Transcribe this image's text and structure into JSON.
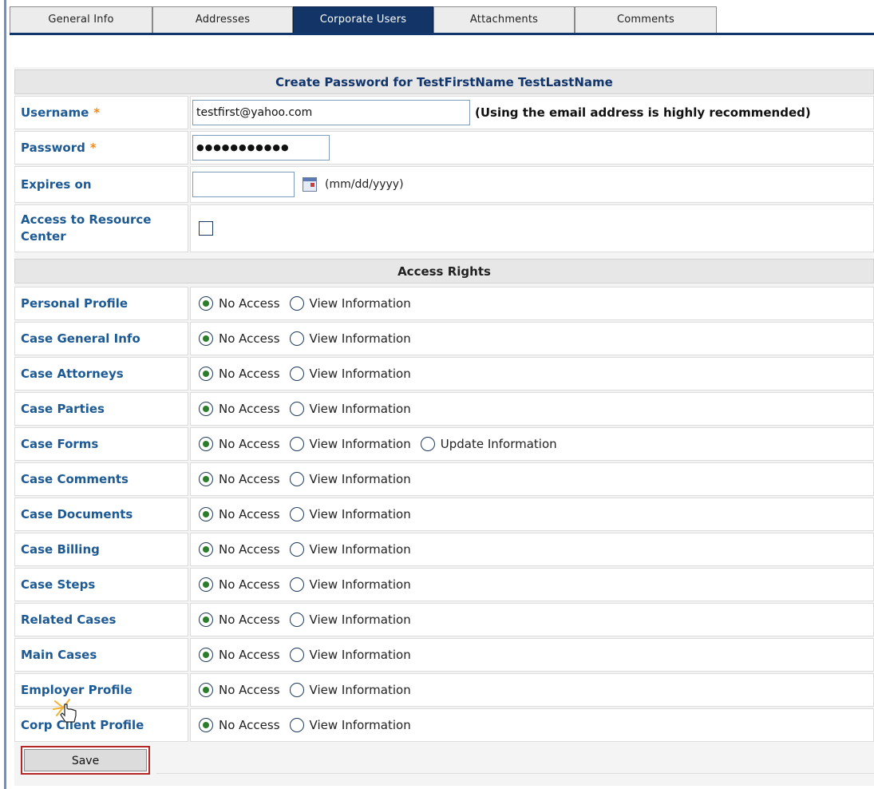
{
  "tabs": [
    {
      "label": "General Info",
      "active": false
    },
    {
      "label": "Addresses",
      "active": false
    },
    {
      "label": "Corporate Users",
      "active": true
    },
    {
      "label": "Attachments",
      "active": false
    },
    {
      "label": "Comments",
      "active": false
    }
  ],
  "form": {
    "header": "Create Password for TestFirstName TestLastName",
    "username": {
      "label": "Username",
      "required_mark": "*",
      "value": "testfirst@yahoo.com",
      "hint": "(Using the email address is highly recommended)"
    },
    "password": {
      "label": "Password",
      "required_mark": "*",
      "value": "●●●●●●●●●●●"
    },
    "expires": {
      "label": "Expires on",
      "value": "",
      "format_hint": "(mm/dd/yyyy)"
    },
    "resource_center": {
      "label": "Access to Resource Center",
      "checked": false
    }
  },
  "access_rights": {
    "header": "Access Rights",
    "options": {
      "no_access": "No Access",
      "view": "View Information",
      "update": "Update Information"
    },
    "rows": [
      {
        "label": "Personal Profile",
        "selected": "No Access"
      },
      {
        "label": "Case General Info",
        "selected": "No Access"
      },
      {
        "label": "Case Attorneys",
        "selected": "No Access"
      },
      {
        "label": "Case Parties",
        "selected": "No Access"
      },
      {
        "label": "Case Forms",
        "selected": "No Access"
      },
      {
        "label": "Case Comments",
        "selected": "No Access"
      },
      {
        "label": "Case Documents",
        "selected": "No Access"
      },
      {
        "label": "Case Billing",
        "selected": "No Access"
      },
      {
        "label": "Case Steps",
        "selected": "No Access"
      },
      {
        "label": "Related Cases",
        "selected": "No Access"
      },
      {
        "label": "Main Cases",
        "selected": "No Access"
      },
      {
        "label": "Employer Profile",
        "selected": "No Access"
      },
      {
        "label": "Corp Client Profile",
        "selected": "No Access"
      }
    ]
  },
  "actions": {
    "save_label": "Save"
  },
  "colors": {
    "tab_active": "#123466",
    "label_blue": "#1d5a94",
    "required_star": "#f08a1c",
    "save_highlight": "#b42525",
    "radio_selected": "#2a7d2a"
  }
}
